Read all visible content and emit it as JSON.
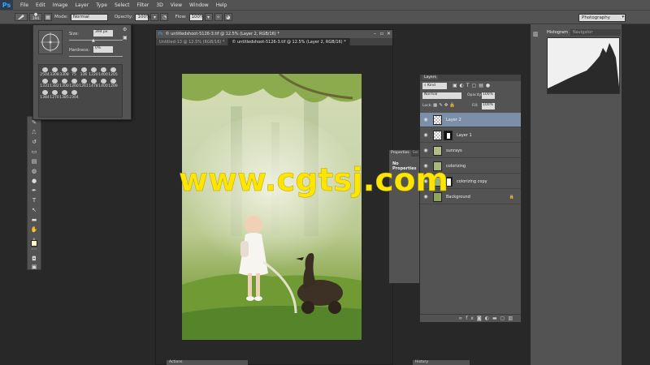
{
  "app": {
    "logo": "Ps",
    "menu": [
      "File",
      "Edit",
      "Image",
      "Layer",
      "Type",
      "Select",
      "Filter",
      "3D",
      "View",
      "Window",
      "Help"
    ]
  },
  "options": {
    "brush_size": "394",
    "mode_label": "Mode:",
    "mode_value": "Normal",
    "opacity_label": "Opacity:",
    "opacity_value": "100%",
    "flow_label": "Flow:",
    "flow_value": "100%",
    "workspace": "Photography"
  },
  "brush_picker": {
    "size_label": "Size:",
    "size_value": "394 px",
    "hardness_label": "Hardness:",
    "hardness_value": "0%",
    "presets": [
      "2504",
      "3308",
      "3308",
      "75",
      "336",
      "1220",
      "1400",
      "1205",
      "1331",
      "1382",
      "1300",
      "1260",
      "1261",
      "1478",
      "1400",
      "1209",
      "1384",
      "1270",
      "1385",
      "2304"
    ]
  },
  "document": {
    "tabs": [
      {
        "label": "Untitled-13 @ 12.5% (RGB/16) *",
        "active": false
      },
      {
        "label": "© untitledshoot-5126-3.tif @ 12.5% (Layer 2, RGB/16) *",
        "active": true
      }
    ],
    "title": "© untitledshoot-5126-3.tif @ 12.5% (Layer 2, RGB/16) *"
  },
  "properties": {
    "tabs": [
      "Properties",
      "Sel"
    ],
    "empty": "No Properties"
  },
  "layers": {
    "title": "Layers",
    "kind": "Kind",
    "blend_mode": "Normal",
    "opacity_label": "Opacity:",
    "opacity_value": "100%",
    "lock_label": "Lock:",
    "fill_label": "Fill:",
    "fill_value": "100%",
    "items": [
      {
        "name": "Layer 2",
        "active": true,
        "mask": false
      },
      {
        "name": "Layer 1",
        "active": false,
        "mask": true
      },
      {
        "name": "sunrays",
        "active": false,
        "mask": false
      },
      {
        "name": "colorizing",
        "active": false,
        "mask": false
      },
      {
        "name": "colorizing copy",
        "active": false,
        "mask": true
      },
      {
        "name": "Background",
        "active": false,
        "mask": false
      }
    ]
  },
  "histogram": {
    "tabs": [
      "Histogram",
      "Navigator"
    ]
  },
  "bottom_panels": {
    "actions": "Actions",
    "history": "History"
  },
  "watermark": "www.cgtsj.com",
  "colors": {
    "panel": "#535353",
    "background": "#282828",
    "active_layer": "#7c8fa8",
    "watermark": "#ffe600",
    "foreground_swatch": "#fff3c8",
    "background_swatch": "#111111"
  }
}
